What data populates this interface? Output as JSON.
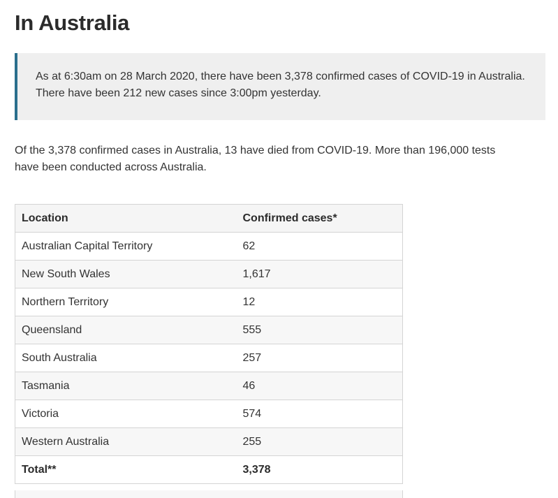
{
  "heading": "In Australia",
  "callout": {
    "text": "As at 6:30am on 28 March 2020, there have been 3,378 confirmed cases of COVID-19 in Australia. There have been 212 new cases since 3:00pm yesterday."
  },
  "intro": "Of the 3,378 confirmed cases in Australia, 13 have died from COVID-19. More than 196,000 tests have been conducted across Australia.",
  "table": {
    "headers": {
      "location": "Location",
      "cases": "Confirmed cases*"
    },
    "rows": [
      {
        "location": "Australian Capital Territory",
        "cases": "62"
      },
      {
        "location": "New South Wales",
        "cases": "1,617"
      },
      {
        "location": "Northern Territory",
        "cases": "12"
      },
      {
        "location": "Queensland",
        "cases": "555"
      },
      {
        "location": "South Australia",
        "cases": "257"
      },
      {
        "location": "Tasmania",
        "cases": "46"
      },
      {
        "location": "Victoria",
        "cases": "574"
      },
      {
        "location": "Western Australia",
        "cases": "255"
      }
    ],
    "total": {
      "label": "Total**",
      "cases": "3,378"
    }
  },
  "colors": {
    "callout_border": "#2a6f8c",
    "callout_background": "#efefef"
  }
}
